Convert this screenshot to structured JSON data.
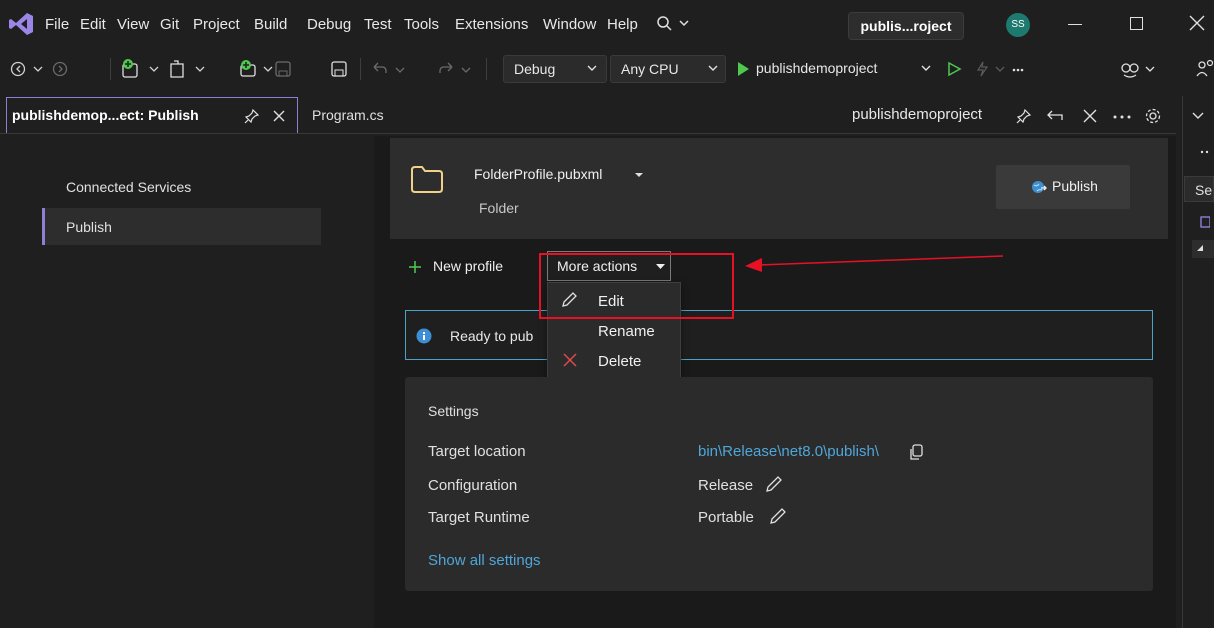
{
  "menubar": {
    "items": [
      "File",
      "Edit",
      "View",
      "Git",
      "Project",
      "Build",
      "Debug",
      "Test",
      "Tools",
      "Extensions",
      "Window",
      "Help"
    ],
    "search_title": "publis...roject",
    "avatar_initials": "SS"
  },
  "toolbar": {
    "config": "Debug",
    "platform": "Any CPU",
    "run_target": "publishdemoproject"
  },
  "tabs": {
    "active_label": "publishdemop...ect: Publish",
    "second_label": "Program.cs",
    "doc_title": "publishdemoproject"
  },
  "leftnav": {
    "items": [
      "Connected Services",
      "Publish"
    ],
    "selected": "Publish"
  },
  "profile": {
    "name": "FolderProfile.pubxml",
    "type": "Folder",
    "publish_label": "Publish"
  },
  "actions": {
    "new_profile": "New profile",
    "more_actions": "More actions",
    "menu_items": [
      "Edit",
      "Rename",
      "Delete"
    ]
  },
  "info": {
    "text": "Ready to pub"
  },
  "settings": {
    "heading": "Settings",
    "rows": [
      {
        "label": "Target location",
        "value": "bin\\Release\\net8.0\\publish\\"
      },
      {
        "label": "Configuration",
        "value": "Release"
      },
      {
        "label": "Target Runtime",
        "value": "Portable"
      }
    ],
    "show_all": "Show all settings"
  },
  "rightpanel": {
    "text": "Se"
  },
  "colors": {
    "accent": "#8b7fd6",
    "link": "#4fa6d8",
    "annotation_red": "#e81123",
    "info_border": "#4aa3c7",
    "run_green": "#4ec94e"
  }
}
